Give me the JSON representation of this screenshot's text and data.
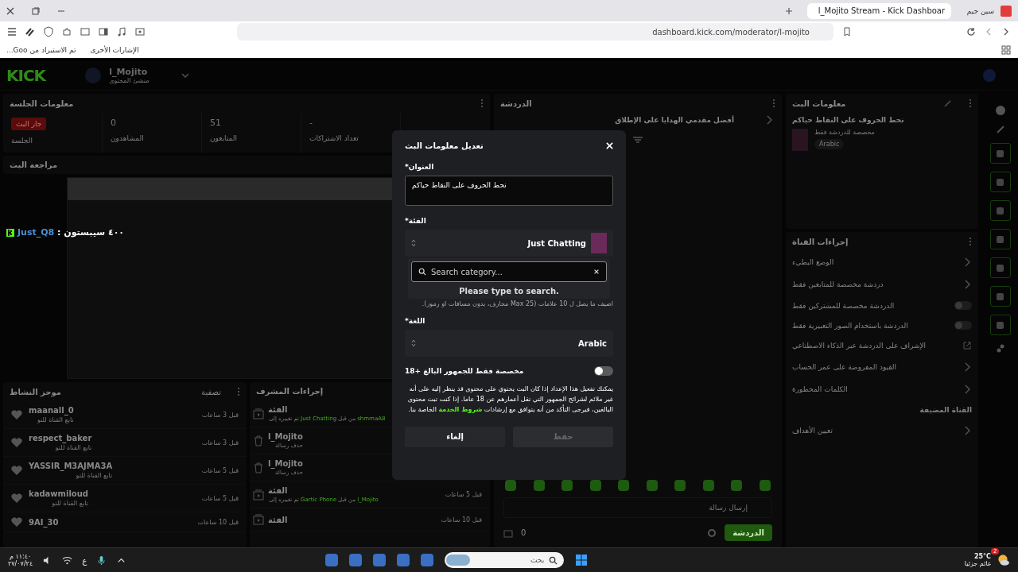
{
  "browser": {
    "profile": "سين جيم",
    "tab": {
      "title": "l_Mojito Stream - Kick Dashboar",
      "selected": true
    },
    "url": "dashboard.kick.com/moderator/l-mojito",
    "bookmarks": [
      "الإشارات الأخرى",
      "تم الاستيراد من Goo..."
    ]
  },
  "header": {
    "logo": "KICK",
    "channel": "l_Mojito",
    "role": "منشئ المحتوى"
  },
  "session": {
    "title": "معلومات الجلسة",
    "live_badge": "جار البث",
    "live_label": "الجلسة",
    "stats": [
      {
        "value": "-",
        "label": "تعداد الاشتراكات"
      },
      {
        "value": "51",
        "label": "المتابعون"
      },
      {
        "value": "0",
        "label": "المشاهدون"
      }
    ]
  },
  "preview": {
    "title": "مراجعة البث",
    "overlay": {
      "user": "Just_Q8",
      "message": ": ٤٠٠ سيبستون"
    }
  },
  "activity": {
    "title": "موجز النشاط",
    "filter": "تصفية",
    "items": [
      {
        "user": "maanall_0",
        "event": "تابع القناة للتو",
        "time": "قبل 3 ساعات"
      },
      {
        "user": "respect_baker",
        "event": "تابع القناة للتو",
        "time": "قبل 3 ساعات"
      },
      {
        "user": "YASSIR_M3AJMA3A",
        "event": "تابع القناة للتو",
        "time": "قبل 5 ساعات"
      },
      {
        "user": "kadawmiloud",
        "event": "تابع القناة للتو",
        "time": "قبل 5 ساعات"
      },
      {
        "user": "9AI_30",
        "time": "قبل 10 ساعات"
      }
    ]
  },
  "mod_actions": {
    "title": "إجراءات المشرف",
    "items": [
      {
        "kind": "category",
        "title": "الفئة",
        "parts": [
          {
            "text": "shmmaA8",
            "highlight": true
          },
          {
            "text": "من قبل",
            "highlight": false
          },
          {
            "text": "Just Chatting",
            "highlight": true
          },
          {
            "text": "تم تغييره إلى",
            "highlight": false
          }
        ]
      },
      {
        "kind": "delete",
        "title": "l_Mojito",
        "detail": "حذف رسالة"
      },
      {
        "kind": "delete",
        "title": "l_Mojito",
        "detail": "حذف رسالة"
      },
      {
        "kind": "category",
        "title": "الفئة",
        "time": "قبل 5 ساعات",
        "parts": [
          {
            "text": "l_Mojito",
            "highlight": true
          },
          {
            "text": "من قبل",
            "highlight": false
          },
          {
            "text": "Gartic Phone",
            "highlight": true
          },
          {
            "text": "تم تغييره إلى",
            "highlight": false
          }
        ]
      },
      {
        "kind": "category",
        "title": "الفئة",
        "time": "قبل 10 ساعات"
      }
    ]
  },
  "chat": {
    "title": "الدردشة",
    "pinned": "أفضل مقدمي الهدايا على الإطلاق",
    "placeholder": "إرسال رسالة",
    "send": "الدردشة",
    "count": "0"
  },
  "stream_info": {
    "title": "معلومات البث",
    "stream_title": "نحط الحروف على النقاط حياكم",
    "category": "مخصصة للدردشة فقط",
    "tag": "Arabic"
  },
  "channel_actions": {
    "title": "إجراءات القناة",
    "items": [
      {
        "kind": "link",
        "label": "الوضع البطيء"
      },
      {
        "kind": "link",
        "label": "دردشة مخصصة للمتابعين فقط"
      },
      {
        "kind": "toggle",
        "label": "الدردشة مخصصة للمشتركين فقط",
        "on": false
      },
      {
        "kind": "toggle",
        "label": "الدردشة باستخدام الصور التعبيرية فقط",
        "on": false
      },
      {
        "kind": "external",
        "label": "الإشراف على الدردشة عبر الذكاء الاصطناعي"
      },
      {
        "kind": "link",
        "label": "القيود المفروضة على عمر الحساب"
      },
      {
        "kind": "link",
        "label": "الكلمات المحظورة"
      },
      {
        "kind": "section",
        "label": "القناة المضيفة"
      },
      {
        "kind": "link",
        "label": "تعيين الأهداف"
      }
    ]
  },
  "modal": {
    "title": "تعديل معلومات البث",
    "title_label": "العنوان*",
    "title_value": "نحط الحروف على النقاط حياكم",
    "category_label": "الفئة*",
    "category_value": "Just Chatting",
    "search_placeholder": "Search category...",
    "search_hint": "Please type to search.",
    "tags_hint": "اضيف ما يصل ل 10 علامات (Max 25 محارف، بدون مسافات او رموز).",
    "language_label": "اللغة*",
    "language_value": "Arabic",
    "mature_label": "مخصصة فقط للجمهور البالغ +18",
    "mature_on": false,
    "mature_before": "يمكنك تفعيل هذا الإعداد إذا كان البث يحتوي على محتوى قد ينظر إليه على أنه غير ملائم لشرائح الجمهور التي تقل أعمارهم عن 18 عاما. إذا كنت تبث محتوى البالغين، فيرجى التأكد من أنه يتوافق مع إرشادات",
    "mature_link": "شروط الخدمة",
    "mature_after": "الخاصة بنا.",
    "cancel": "إلغاء",
    "save": {
      "label": "حفظ",
      "disabled": true
    }
  },
  "taskbar": {
    "temp": "25°C",
    "weather": "غائم جزئيا",
    "alert": "2",
    "search_placeholder": "بحث",
    "lang": "ع",
    "time": "١١:٤٠ م",
    "date": "٢٧/٠٧/٢٤"
  }
}
